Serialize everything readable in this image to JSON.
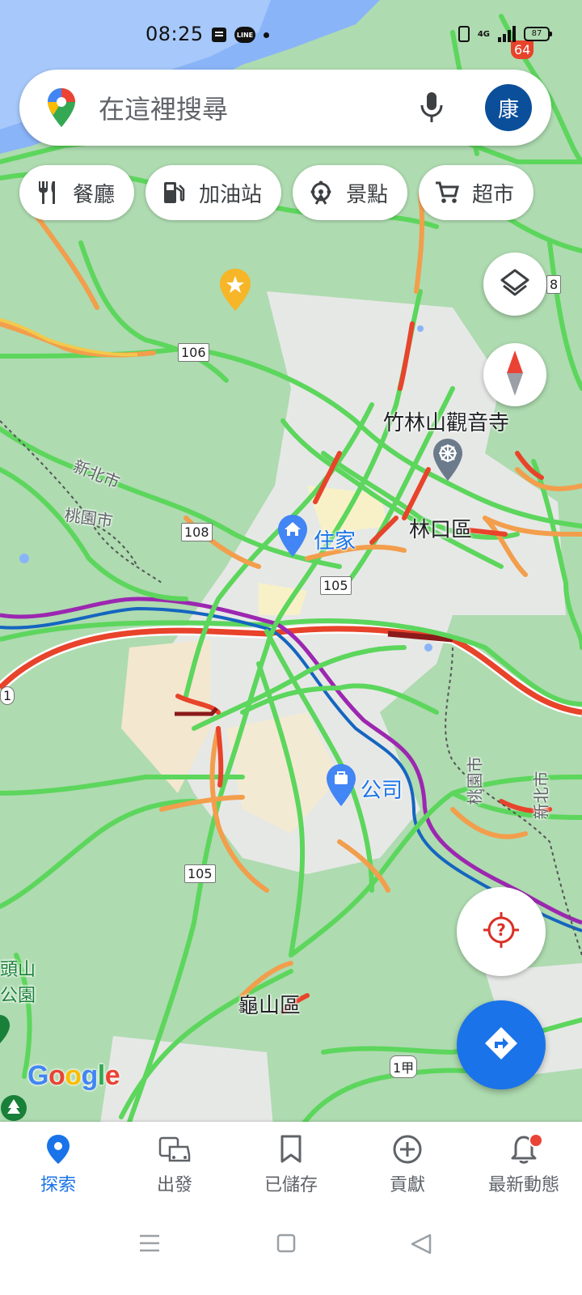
{
  "status_bar": {
    "time": "08:25",
    "line_badge": "LINE",
    "network": "4G",
    "battery": "87"
  },
  "search": {
    "placeholder": "在這裡搜尋",
    "avatar_initial": "康"
  },
  "chips": [
    {
      "label": "餐廳",
      "icon": "restaurant-icon"
    },
    {
      "label": "加油站",
      "icon": "gas-station-icon"
    },
    {
      "label": "景點",
      "icon": "attractions-icon"
    },
    {
      "label": "超市",
      "icon": "shopping-cart-icon"
    }
  ],
  "map": {
    "labels": {
      "temple": "竹林山觀音寺",
      "home": "住家",
      "linkou": "林口區",
      "new_taipei": "新北市",
      "taoyuan": "桃園市",
      "company": "公司",
      "guishan": "龜山區",
      "taoyuan_v": "桃園市",
      "new_taipei_v": "新北市",
      "park_a": "頭山",
      "park_b": "公園"
    },
    "shields": {
      "r106": "106",
      "r108": "108",
      "r105a": "105",
      "r105b": "105",
      "r1jia": "1甲",
      "r64": "64",
      "r8": "8",
      "r1": "1"
    },
    "logo": "Google",
    "colors": {
      "green": "#34a853",
      "traffic_green": "#5cd65c",
      "orange": "#f29e4c",
      "red": "#e8432b",
      "darkred": "#8b1a1a",
      "purple": "#9c27b0",
      "blue": "#1565c0"
    }
  },
  "nav": [
    {
      "label": "探索",
      "icon": "explore-pin-icon"
    },
    {
      "label": "出發",
      "icon": "commute-icon"
    },
    {
      "label": "已儲存",
      "icon": "bookmark-icon"
    },
    {
      "label": "貢獻",
      "icon": "add-circle-icon"
    },
    {
      "label": "最新動態",
      "icon": "notifications-icon"
    }
  ]
}
